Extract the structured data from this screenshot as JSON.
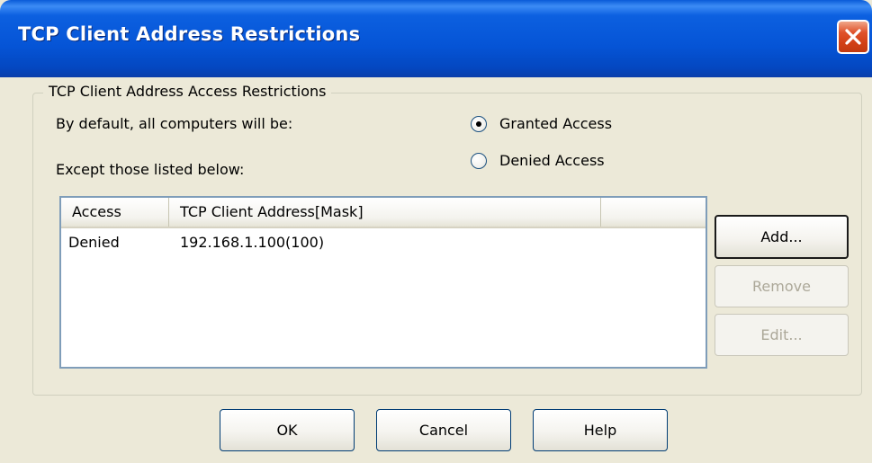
{
  "window": {
    "title": "TCP Client Address Restrictions",
    "close_icon": "close-icon"
  },
  "group": {
    "label": "TCP Client Address Access Restrictions",
    "default_label": "By default, all computers will be:",
    "except_label": "Except those listed below:",
    "radio_options": [
      {
        "label": "Granted Access",
        "selected": true
      },
      {
        "label": "Denied Access",
        "selected": false
      }
    ]
  },
  "list": {
    "columns": [
      "Access",
      "TCP Client Address[Mask]",
      ""
    ],
    "rows": [
      {
        "access": "Denied",
        "address": "192.168.1.100(100)"
      }
    ]
  },
  "side_buttons": {
    "add": {
      "label": "Add...",
      "enabled": true
    },
    "remove": {
      "label": "Remove",
      "enabled": false
    },
    "edit": {
      "label": "Edit...",
      "enabled": false
    }
  },
  "footer_buttons": {
    "ok": "OK",
    "cancel": "Cancel",
    "help": "Help"
  },
  "colors": {
    "titlebar": "#0554d6",
    "dialog_bg": "#ece9d8",
    "close_button": "#d24015",
    "disabled_text": "#aca899"
  }
}
